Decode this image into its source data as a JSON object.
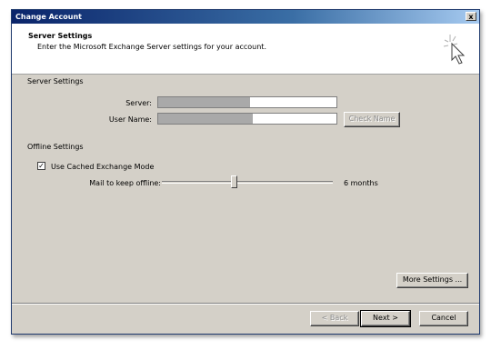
{
  "window": {
    "title": "Change Account",
    "close_glyph": "x"
  },
  "header": {
    "title": "Server Settings",
    "subtitle": "Enter the Microsoft Exchange Server settings for your account.",
    "icon": "wizard-cursor-icon"
  },
  "server_settings": {
    "section_label": "Server Settings",
    "server_label": "Server:",
    "server_value": "",
    "username_label": "User Name:",
    "username_value": "",
    "check_name_label": "Check Name"
  },
  "offline_settings": {
    "section_label": "Offline Settings",
    "cached_mode_label": "Use Cached Exchange Mode",
    "cached_mode_checked": true,
    "mail_offline_label": "Mail to keep offline:",
    "mail_offline_value": "6 months",
    "slider_position_fraction": 0.42
  },
  "buttons": {
    "more_settings": "More Settings ...",
    "back": "< Back",
    "next": "Next >",
    "cancel": "Cancel"
  }
}
